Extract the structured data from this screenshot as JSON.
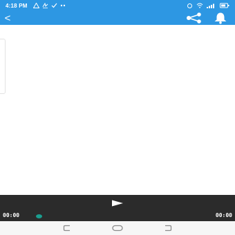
{
  "status_bar": {
    "time": "4:18 PM",
    "notification_icons": [
      "warning-icon",
      "signature-icon",
      "check-icon",
      "more-icon"
    ],
    "system_icons": [
      "alarm-icon",
      "wifi-icon",
      "signal-icon",
      "battery-icon"
    ]
  },
  "app_bar": {
    "background": "#2d97e3",
    "back_label": "<",
    "actions": [
      "share-icon",
      "bell-icon"
    ]
  },
  "player": {
    "background": "#2b2b2b",
    "elapsed_time": "00:00",
    "total_time": "00:00",
    "progress": 0,
    "thumb_color": "#1a9e8f"
  },
  "navigation_bar": {
    "buttons": [
      "recents-button",
      "home-button",
      "back-button"
    ]
  }
}
